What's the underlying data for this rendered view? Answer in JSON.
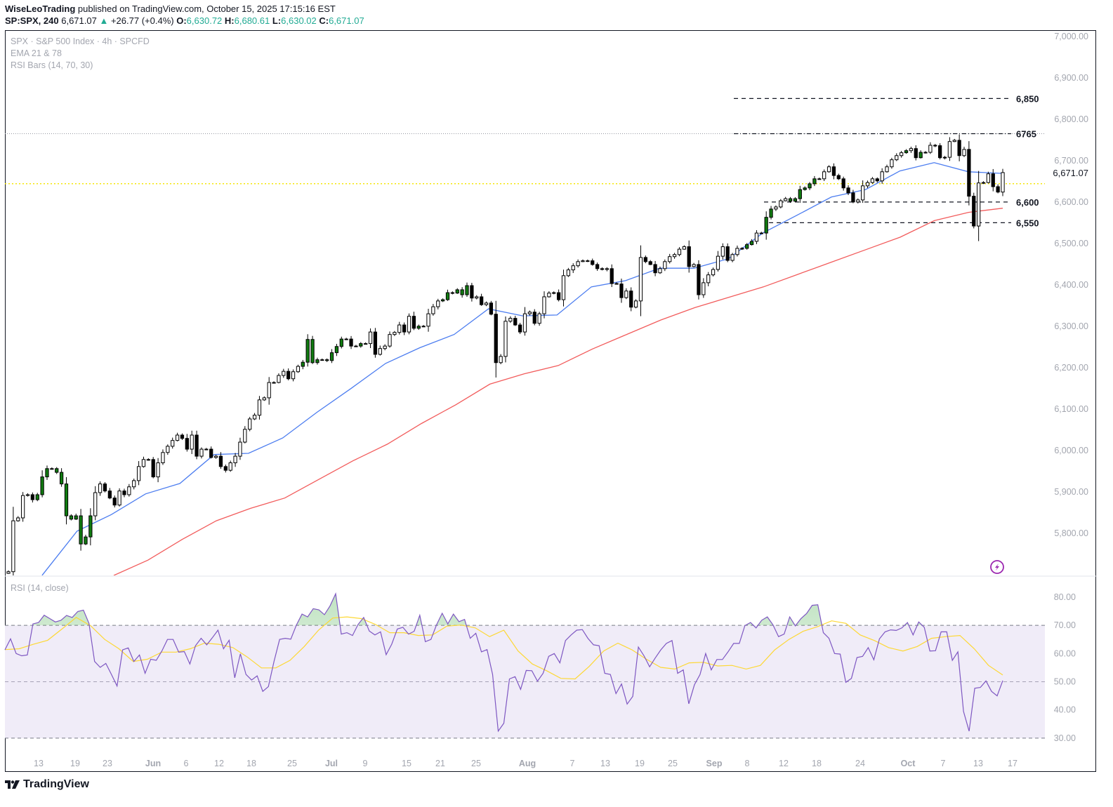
{
  "header": {
    "author": "WiseLeoTrading",
    "published": "published on TradingView.com, October 15, 2025 17:15:16 EST",
    "symbol": "SP:SPX, 240",
    "price": "6,671.07",
    "arrow": "▲",
    "change": "+26.77 (+0.4%)",
    "o_label": "O:",
    "o": "6,630.72",
    "h_label": "H:",
    "h": "6,680.61",
    "l_label": "L:",
    "l": "6,630.02",
    "c_label": "C:",
    "c": "6,671.07"
  },
  "legend": {
    "line1": "SPX · S&P 500 Index · 4h · SPCFD",
    "line2": "EMA 21 & 78",
    "line3": "RSI Bars (14, 70, 30)",
    "rsi": "RSI (14, close)"
  },
  "logo": {
    "text": "TradingView"
  },
  "colors": {
    "up_body": "#ffffff",
    "down_body": "#000000",
    "overbought_body": "#107c10",
    "ema21": "#4c7df0",
    "ema78": "#f25c5c",
    "rsi": "#7e57c2",
    "rsi_ma": "#fdd835",
    "rsi_band": "#f0ecf8",
    "prev_close_line": "#f5e60a",
    "change_up": "#22ab94",
    "alert_icon": "#9c27b0"
  },
  "icons": {
    "alert": "lightning-circle-icon"
  },
  "chart_data": [
    {
      "type": "candlestick",
      "symbol": "SPX",
      "interval": "4h",
      "ylim": [
        5698,
        7015
      ],
      "y_ticks": [
        7000,
        6900,
        6800,
        6700,
        6600,
        6500,
        6400,
        6300,
        6200,
        6100,
        6000,
        5900,
        5800
      ],
      "y_tick_labels": [
        "7,000.00",
        "6,900.00",
        "6,800.00",
        "6,700.00",
        "6,600.00",
        "6,500.00",
        "6,400.00",
        "6,300.00",
        "6,200.00",
        "6,100.00",
        "6,000.00",
        "5,900.00",
        "5,800.00"
      ],
      "x_tick_labels": [
        "13",
        "19",
        "23",
        "Jun",
        "6",
        "12",
        "18",
        "25",
        "Jul",
        "9",
        "15",
        "21",
        "25",
        "Aug",
        "7",
        "13",
        "19",
        "25",
        "Sep",
        "8",
        "12",
        "18",
        "24",
        "Oct",
        "7",
        "13",
        "17"
      ],
      "grid": false,
      "closes": [
        5707,
        5830,
        5837,
        5891,
        5893,
        5881,
        5893,
        5936,
        5956,
        5956,
        5947,
        5919,
        5842,
        5834,
        5842,
        5774,
        5791,
        5842,
        5898,
        5919,
        5902,
        5885,
        5868,
        5902,
        5893,
        5912,
        5927,
        5961,
        5978,
        5978,
        5936,
        5970,
        5995,
        6010,
        6024,
        6037,
        6029,
        6003,
        6037,
        5986,
        6003,
        6003,
        5983,
        5986,
        5961,
        5952,
        5970,
        5986,
        6020,
        6051,
        6076,
        6085,
        6122,
        6127,
        6164,
        6164,
        6181,
        6191,
        6173,
        6190,
        6203,
        6213,
        6268,
        6212,
        6219,
        6219,
        6217,
        6236,
        6251,
        6269,
        6269,
        6252,
        6252,
        6258,
        6258,
        6286,
        6232,
        6246,
        6252,
        6280,
        6285,
        6303,
        6286,
        6324,
        6295,
        6300,
        6300,
        6330,
        6347,
        6361,
        6364,
        6381,
        6380,
        6388,
        6376,
        6398,
        6368,
        6371,
        6352,
        6356,
        6329,
        6212,
        6227,
        6312,
        6319,
        6303,
        6286,
        6330,
        6334,
        6307,
        6330,
        6371,
        6380,
        6381,
        6364,
        6422,
        6436,
        6446,
        6456,
        6458,
        6458,
        6449,
        6439,
        6437,
        6439,
        6403,
        6402,
        6369,
        6385,
        6346,
        6361,
        6466,
        6456,
        6449,
        6429,
        6439,
        6456,
        6468,
        6473,
        6486,
        6492,
        6444,
        6449,
        6376,
        6405,
        6424,
        6437,
        6469,
        6492,
        6459,
        6473,
        6488,
        6488,
        6497,
        6505,
        6525,
        6525,
        6563,
        6583,
        6588,
        6603,
        6608,
        6602,
        6608,
        6630,
        6634,
        6644,
        6656,
        6656,
        6673,
        6685,
        6664,
        6656,
        6634,
        6622,
        6600,
        6605,
        6639,
        6647,
        6656,
        6651,
        6673,
        6685,
        6702,
        6712,
        6719,
        6724,
        6729,
        6707,
        6720,
        6720,
        6737,
        6736,
        6707,
        6708,
        6746,
        6749,
        6712,
        6727,
        6614,
        6542,
        6646,
        6647,
        6668,
        6637,
        6624,
        6671.07
      ],
      "ema21": [
        5560,
        5700,
        5805,
        5845,
        5895,
        5920,
        5990,
        5993,
        6030,
        6092,
        6150,
        6210,
        6248,
        6280,
        6342,
        6325,
        6327,
        6395,
        6410,
        6440,
        6440,
        6463,
        6525,
        6568,
        6612,
        6630,
        6675,
        6695,
        6673,
        6669
      ],
      "ema78": [
        5698,
        5735,
        5785,
        5830,
        5860,
        5885,
        5930,
        5975,
        6015,
        6065,
        6110,
        6160,
        6185,
        6205,
        6245,
        6280,
        6315,
        6345,
        6370,
        6395,
        6425,
        6455,
        6485,
        6515,
        6555,
        6575,
        6585
      ],
      "series_names": [
        "EMA 21",
        "EMA 78"
      ],
      "levels": [
        {
          "value": 6850,
          "label": "6,850",
          "style": "dashed"
        },
        {
          "value": 6765,
          "label": "6765",
          "style": "dash-dot"
        },
        {
          "value": 6600,
          "label": "6,600",
          "style": "dashed"
        },
        {
          "value": 6550,
          "label": "6,550",
          "style": "dashed"
        }
      ],
      "prev_close": 6644.3,
      "last_price": 6671.07,
      "last_price_label": "6,671.07"
    },
    {
      "type": "line",
      "title": "RSI (14, close)",
      "ylim": [
        25.5,
        87.2
      ],
      "y_ticks": [
        80,
        70,
        60,
        50,
        40,
        30
      ],
      "y_tick_labels": [
        "80.00",
        "70.00",
        "60.00",
        "50.00",
        "40.00",
        "30.00"
      ],
      "bands": {
        "upper": 70,
        "middle": 50,
        "lower": 30
      },
      "rsi": [
        61.3,
        65.2,
        60,
        59.2,
        59.5,
        70.5,
        71,
        73.6,
        72.4,
        71.2,
        71.8,
        73.5,
        72.8,
        74.9,
        75.4,
        70.7,
        57.2,
        55.1,
        56.5,
        52.6,
        48.5,
        61.3,
        62,
        57.2,
        59.5,
        53,
        58,
        57.6,
        60.9,
        65,
        65,
        60.5,
        60.7,
        56.3,
        62.8,
        65.4,
        63.1,
        65.6,
        68.3,
        61.7,
        64.7,
        51.4,
        59.9,
        52.6,
        50.6,
        52.1,
        46.6,
        48.3,
        57.2,
        65,
        65.4,
        65.1,
        70.1,
        74,
        73,
        75.9,
        75.5,
        73.8,
        76.9,
        81.2,
        66.9,
        67.4,
        66.4,
        70.3,
        72.8,
        68,
        66.6,
        67.7,
        59.6,
        63.3,
        68.7,
        69.3,
        66.9,
        67.9,
        73.6,
        64.2,
        65,
        70.2,
        74.3,
        70.5,
        74,
        71.3,
        72.1,
        65.4,
        67.2,
        60.6,
        61.4,
        52.6,
        32.5,
        35.3,
        51,
        51.8,
        47.3,
        54,
        53.9,
        50.2,
        53,
        59,
        60,
        56.7,
        64.6,
        66.6,
        68.3,
        68.5,
        65.4,
        63.1,
        62.8,
        53,
        52.6,
        45.8,
        49.2,
        42.1,
        44.8,
        62.3,
        59.2,
        55.3,
        58.4,
        61.3,
        63.6,
        64.6,
        53,
        54.2,
        42.2,
        48.9,
        52.6,
        60,
        54.2,
        57.9,
        57.9,
        60.6,
        63.6,
        63.6,
        69.9,
        71,
        69.1,
        71.8,
        73,
        70.2,
        66,
        66.9,
        73,
        69.8,
        72.4,
        74.2,
        77.1,
        77.3,
        67.4,
        65.4,
        60,
        59.8,
        49.8,
        51.2,
        58.6,
        59,
        62.1,
        57.8,
        65.2,
        67.7,
        68.4,
        68.2,
        69.1,
        71,
        66.6,
        71.2,
        69.3,
        60.9,
        61,
        67.7,
        67.7,
        57.6,
        60.6,
        39.5,
        32.5,
        47.7,
        48,
        50.3,
        46.6,
        45,
        50.4
      ],
      "rsi_ma": [
        61.4,
        61.7,
        63.3,
        64.7,
        68.7,
        72.8,
        69.9,
        65,
        61.7,
        57.2,
        58,
        60.5,
        60.5,
        61.7,
        63.7,
        63.3,
        62.1,
        58.8,
        54.9,
        54.9,
        57.6,
        62.5,
        68.3,
        72.6,
        73,
        72.4,
        70.3,
        67.4,
        67.4,
        66.4,
        66.6,
        69.7,
        70.1,
        69.1,
        66,
        68.3,
        60.9,
        56.3,
        53.9,
        51.2,
        51,
        55.5,
        60.9,
        63.7,
        61.3,
        58,
        55.1,
        54.5,
        56.7,
        56.9,
        55.6,
        55.8,
        54.5,
        55.8,
        61.3,
        65,
        67.9,
        69.5,
        71.6,
        70.7,
        66.6,
        64.6,
        62.1,
        60.9,
        62.5,
        65.4,
        66,
        66.4,
        61.7,
        55.8,
        52.4
      ]
    }
  ]
}
